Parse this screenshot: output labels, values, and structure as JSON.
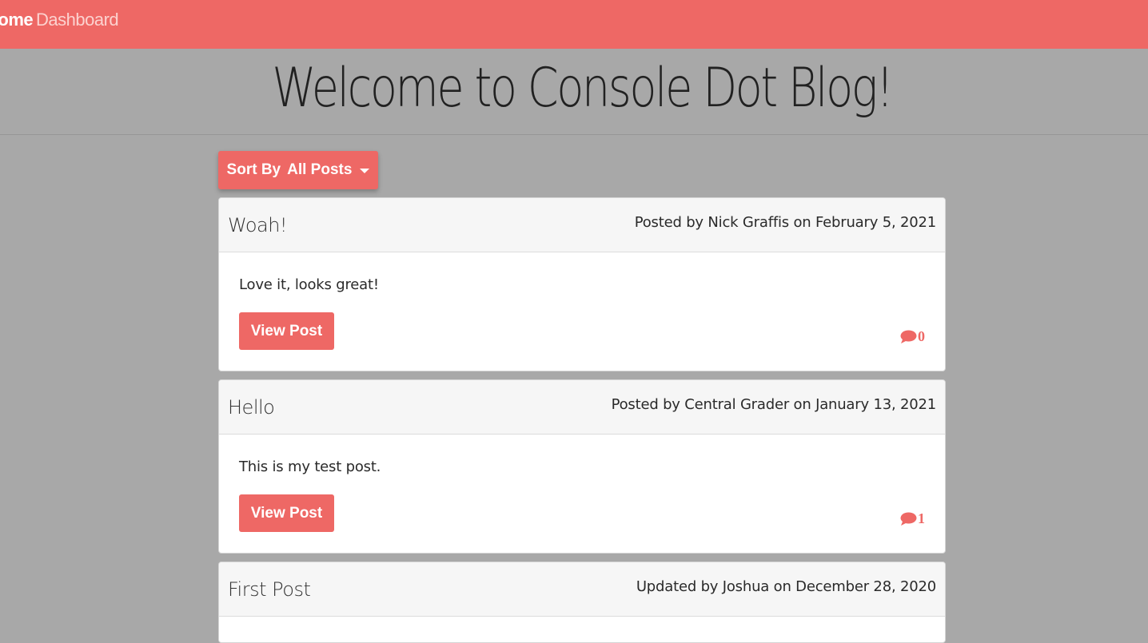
{
  "nav": {
    "home": "Home",
    "dashboard": "Dashboard"
  },
  "hero": {
    "title": "Welcome to Console Dot Blog!"
  },
  "sort": {
    "prefix": "Sort By",
    "value": "All Posts"
  },
  "posts": [
    {
      "title": "Woah!",
      "meta": "Posted by Nick Graffis on February 5, 2021",
      "body": "Love it, looks great!",
      "button": "View Post",
      "comments": "0"
    },
    {
      "title": "Hello",
      "meta": "Posted by Central Grader on January 13, 2021",
      "body": "This is my test post.",
      "button": "View Post",
      "comments": "1"
    },
    {
      "title": "First Post",
      "meta": "Updated by Joshua on December 28, 2020"
    }
  ],
  "colors": {
    "accent": "#ee6865",
    "background": "#a8a8a8"
  }
}
